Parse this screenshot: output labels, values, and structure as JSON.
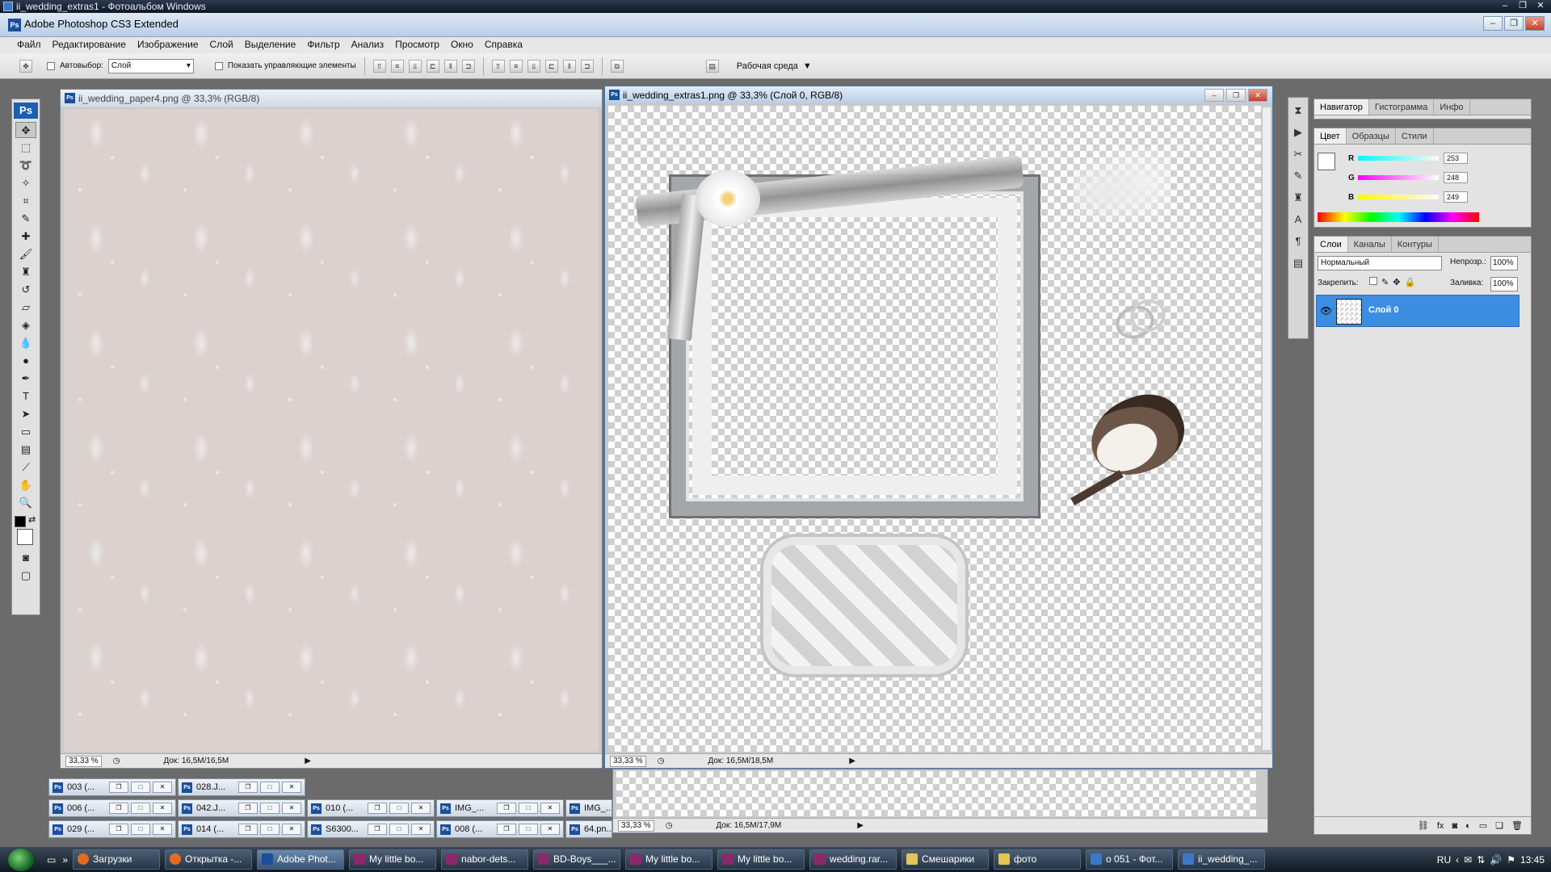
{
  "outer_title": "ii_wedding_extras1 - Фотоальбом Windows",
  "app_title": "Adobe Photoshop CS3 Extended",
  "menu": [
    "Файл",
    "Редактирование",
    "Изображение",
    "Слой",
    "Выделение",
    "Фильтр",
    "Анализ",
    "Просмотр",
    "Окно",
    "Справка"
  ],
  "options_bar": {
    "autoselect_label": "Автовыбор:",
    "autoselect_value": "Слой",
    "show_controls_label": "Показать управляющие элементы",
    "workspace_label": "Рабочая среда"
  },
  "toolbox": {
    "logo": "Ps"
  },
  "doc_left": {
    "title": "ii_wedding_paper4.png @ 33,3% (RGB/8)",
    "zoom": "33,33 %",
    "doc_info": "Док: 16,5М/16,5М"
  },
  "doc_right": {
    "title": "ii_wedding_extras1.png @ 33,3% (Слой 0, RGB/8)",
    "zoom": "33,33 %",
    "doc_info": "Док: 16,5М/18,5М"
  },
  "doc_bottom": {
    "zoom": "33,33 %",
    "doc_info": "Док: 16,5М/17,9М"
  },
  "minimized_docs": [
    {
      "label": "003 (..."
    },
    {
      "label": "028.J..."
    },
    {
      "label": "006 (..."
    },
    {
      "label": "042.J..."
    },
    {
      "label": "010 (..."
    },
    {
      "label": "IMG_..."
    },
    {
      "label": "IMG_..."
    },
    {
      "label": "029 (..."
    },
    {
      "label": "014 (..."
    },
    {
      "label": "S6300..."
    },
    {
      "label": "008 (..."
    },
    {
      "label": "64.pn..."
    }
  ],
  "navigator_panel": {
    "tabs": [
      "Навигатор",
      "Гистограмма",
      "Инфо"
    ]
  },
  "color_panel": {
    "tabs": [
      "Цвет",
      "Образцы",
      "Стили"
    ],
    "r_label": "R",
    "r_value": "253",
    "g_label": "G",
    "g_value": "248",
    "b_label": "B",
    "b_value": "249"
  },
  "layers_panel": {
    "tabs": [
      "Слои",
      "Каналы",
      "Контуры"
    ],
    "blend_mode": "Нормальный",
    "opacity_label": "Непрозр.:",
    "opacity_value": "100%",
    "lock_label": "Закрепить:",
    "fill_label": "Заливка:",
    "fill_value": "100%",
    "layer_name": "Слой 0"
  },
  "taskbar": {
    "buttons": [
      "Загрузки",
      "Открытка -...",
      "Adobe Phot...",
      "My little bo...",
      "nabor-dets...",
      "BD-Boys___...",
      "My little bo...",
      "My little bo...",
      "wedding.rar...",
      "Смешарики",
      "фото",
      "о 051 - Фот...",
      "ii_wedding_..."
    ],
    "lang": "RU",
    "clock": "13:45"
  },
  "colors": {
    "accent": "#3d8ee3",
    "layer_selected": "#3d8ee3"
  }
}
